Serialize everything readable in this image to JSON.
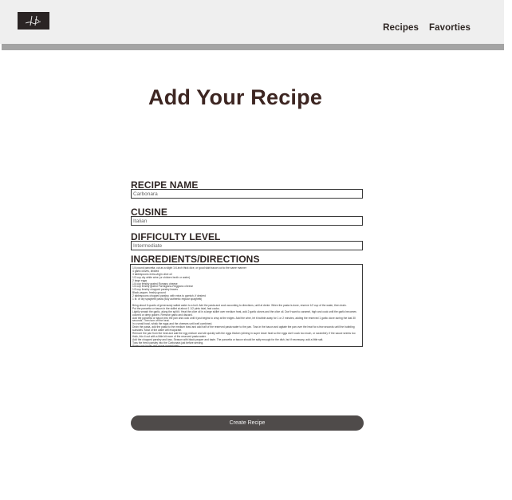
{
  "header": {
    "logo_icon": "signature-logo-icon",
    "nav": {
      "recipes_label": "Recipes",
      "favorites_label": "Favorties"
    }
  },
  "form": {
    "title": "Add Your Recipe",
    "recipe_name": {
      "label": "RECIPE NAME",
      "value": "Carbonara"
    },
    "cuisine": {
      "label": "CUSINE",
      "value": "Italian"
    },
    "difficulty": {
      "label": "DIFFICULTY LEVEL",
      "value": "Intermediate"
    },
    "ingredients": {
      "label": "INGREDIENTS/DIRECTIONS",
      "value": "1/4 pound pancetta, cut as a slight 1/4-inch thick dice, or good slab bacon cut to the same manner\n4 garlic cloves, divided\n3 tablespoons extra-virgin olive oil\n1/2 cup dry white wine (or chicken broth or water)\n2 large eggs\n1/4 cup freshly grated Romano cheese\n1/4 cup freshly grated Parmigiano-Reggiano cheese\n1/3 cup freshly chopped parsley leaves\nBlack pepper, freshly ground\n2 tablespoons chopped parsley, with extra to garnish, if desired\n1 lb. of dry spaghetti pasta (Buy authentic regular spaghetti)\n\nBring about 6 quarts of generously salted water to a boil. Add the pasta and cook according to directions, until al dente. When the pasta is done, reserve 1/2 cup of the water, then drain.\nPut the pancetta or bacon in the skillet at about 1 1/2 pints total, fast cooks.\nLightly smash the garlic, along the split it. Heat the olive oil in a large skillet over medium heat, add 2 garlic cloves and the olive oil. Don't want to caramel, high and cook until the garlic becomes colored or deep golden. Remove garlic and discard.\nAdd the pancetta or bacon into the pan and cook until it just begins to crisp at the edges. Add the wine, let it bubble away for 1 or 2 minutes, adding the reserved 1 garlic clove during the last 30 seconds. Then turn off the heat.\nIn a small bowl, whisk the eggs and the cheeses until well combined.\nDrain the pasta, add the pasta to the medium bowl and add half of the reserved pasta water to the pan. Toss in the bacon and agitate the pan over the heat for a few seconds until the bubbling subsides. Most of the water will evaporate.\nRemove the pan from the heat and add the egg mixture and stir quickly with the eggs thicken (stirring in super lower heat so the eggs don't cook too much, or scramble). If the sauce seems too thick, thin it out with a little bit more of the reserved pasta water.\nAdd the chopped parsley and toss. Season with black pepper and taste. The pancetta or bacon should be salty enough for the dish, but if necessary, add a little salt.\nToss the fresh parsley into the Carbonara just before serving.\nPlated into bowls and serve immediately."
    },
    "submit_label": "Create Recipe"
  }
}
